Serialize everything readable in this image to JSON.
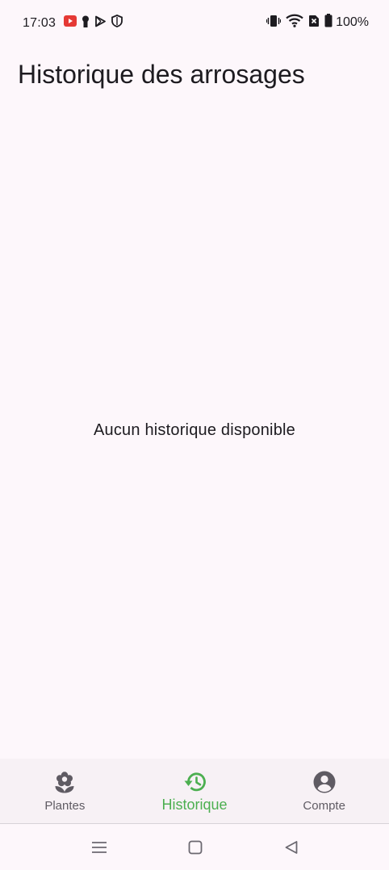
{
  "status_bar": {
    "time": "17:03",
    "battery_percent": "100%",
    "left_icons": [
      "youtube-notification-icon",
      "keyhole-icon",
      "play-store-icon",
      "shield-icon"
    ],
    "right_icons": [
      "vibrate-icon",
      "wifi-icon",
      "no-sim-icon",
      "battery-icon"
    ]
  },
  "app_bar": {
    "title": "Historique des arrosages"
  },
  "main": {
    "empty_message": "Aucun historique disponible"
  },
  "bottom_nav": {
    "items": [
      {
        "label": "Plantes",
        "icon": "plant-icon",
        "active": false
      },
      {
        "label": "Historique",
        "icon": "history-icon",
        "active": true
      },
      {
        "label": "Compte",
        "icon": "account-circle-icon",
        "active": false
      }
    ]
  },
  "system_nav": {
    "buttons": [
      "menu-icon",
      "home-icon",
      "back-icon"
    ]
  },
  "colors": {
    "background": "#fdf7fb",
    "nav_background": "#f7f1f5",
    "accent": "#4caf50",
    "text": "#1d1b20",
    "inactive": "#5f5b63"
  }
}
